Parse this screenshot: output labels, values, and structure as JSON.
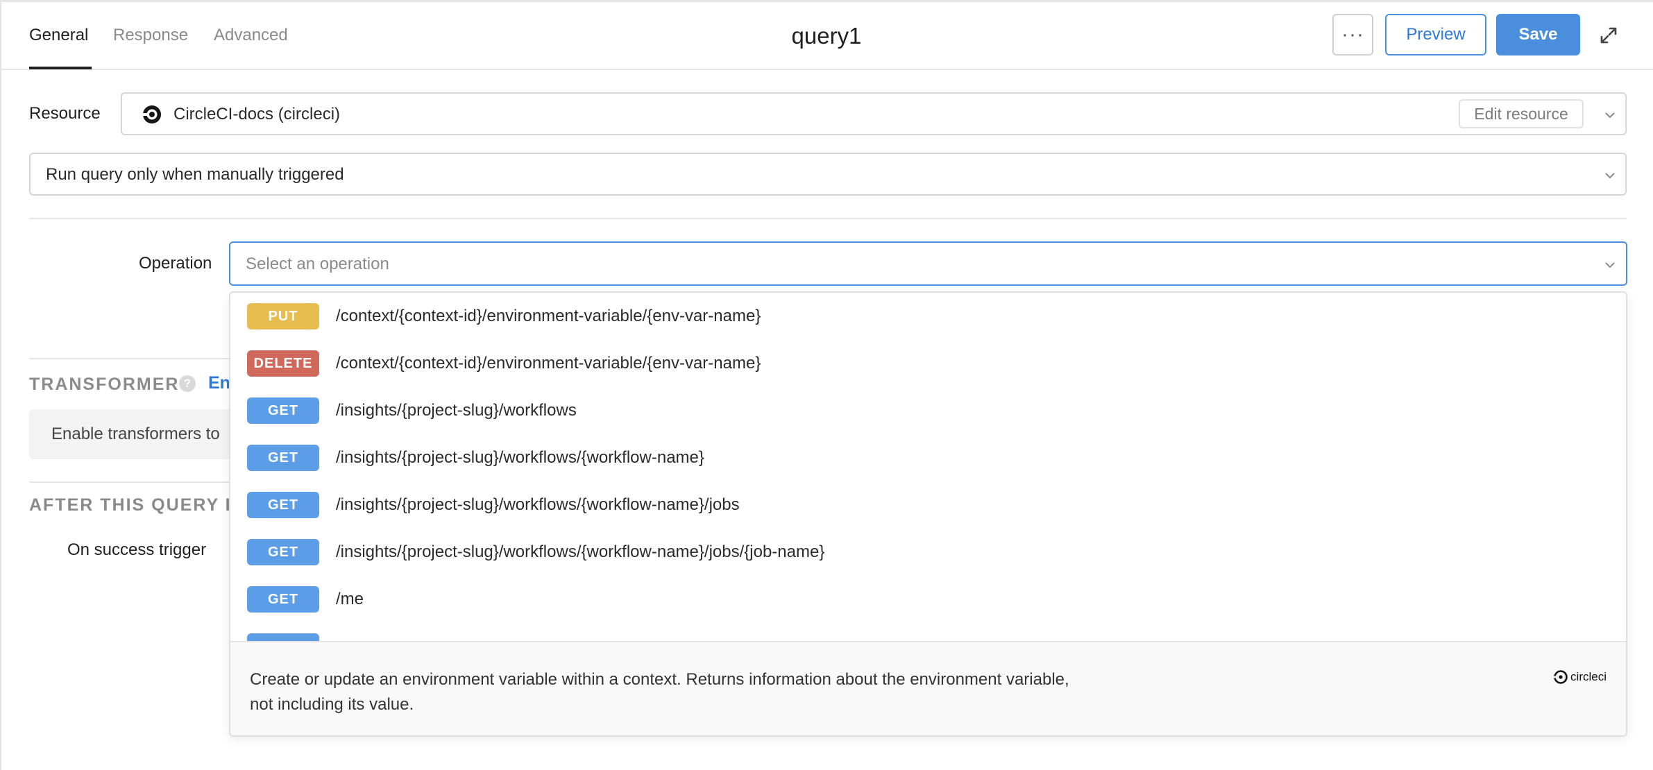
{
  "header": {
    "tabs": [
      {
        "label": "General",
        "active": true
      },
      {
        "label": "Response",
        "active": false
      },
      {
        "label": "Advanced",
        "active": false
      }
    ],
    "title": "query1",
    "more_label": "···",
    "preview_label": "Preview",
    "save_label": "Save"
  },
  "resource": {
    "label": "Resource",
    "value": "CircleCI-docs (circleci)",
    "edit_label": "Edit resource"
  },
  "trigger": {
    "value": "Run query only when manually triggered"
  },
  "operation": {
    "label": "Operation",
    "placeholder": "Select an operation",
    "items": [
      {
        "method": "PUT",
        "path": "/context/{context-id}/environment-variable/{env-var-name}"
      },
      {
        "method": "DELETE",
        "path": "/context/{context-id}/environment-variable/{env-var-name}"
      },
      {
        "method": "GET",
        "path": "/insights/{project-slug}/workflows"
      },
      {
        "method": "GET",
        "path": "/insights/{project-slug}/workflows/{workflow-name}"
      },
      {
        "method": "GET",
        "path": "/insights/{project-slug}/workflows/{workflow-name}/jobs"
      },
      {
        "method": "GET",
        "path": "/insights/{project-slug}/workflows/{workflow-name}/jobs/{job-name}"
      },
      {
        "method": "GET",
        "path": "/me"
      }
    ],
    "description": "Create or update an environment variable within a context. Returns information about the environment variable, not including its value.",
    "brand_text": "circleci"
  },
  "transformer": {
    "title": "TRANSFORMER",
    "help": "?",
    "enable_link": "En",
    "box_text": "Enable transformers to"
  },
  "after_query": {
    "title": "AFTER THIS QUERY RU",
    "success_label": "On success trigger"
  },
  "colors": {
    "put": "#e8bd4f",
    "delete": "#d0685c",
    "get": "#5b9de6",
    "accent": "#4a90e2"
  }
}
